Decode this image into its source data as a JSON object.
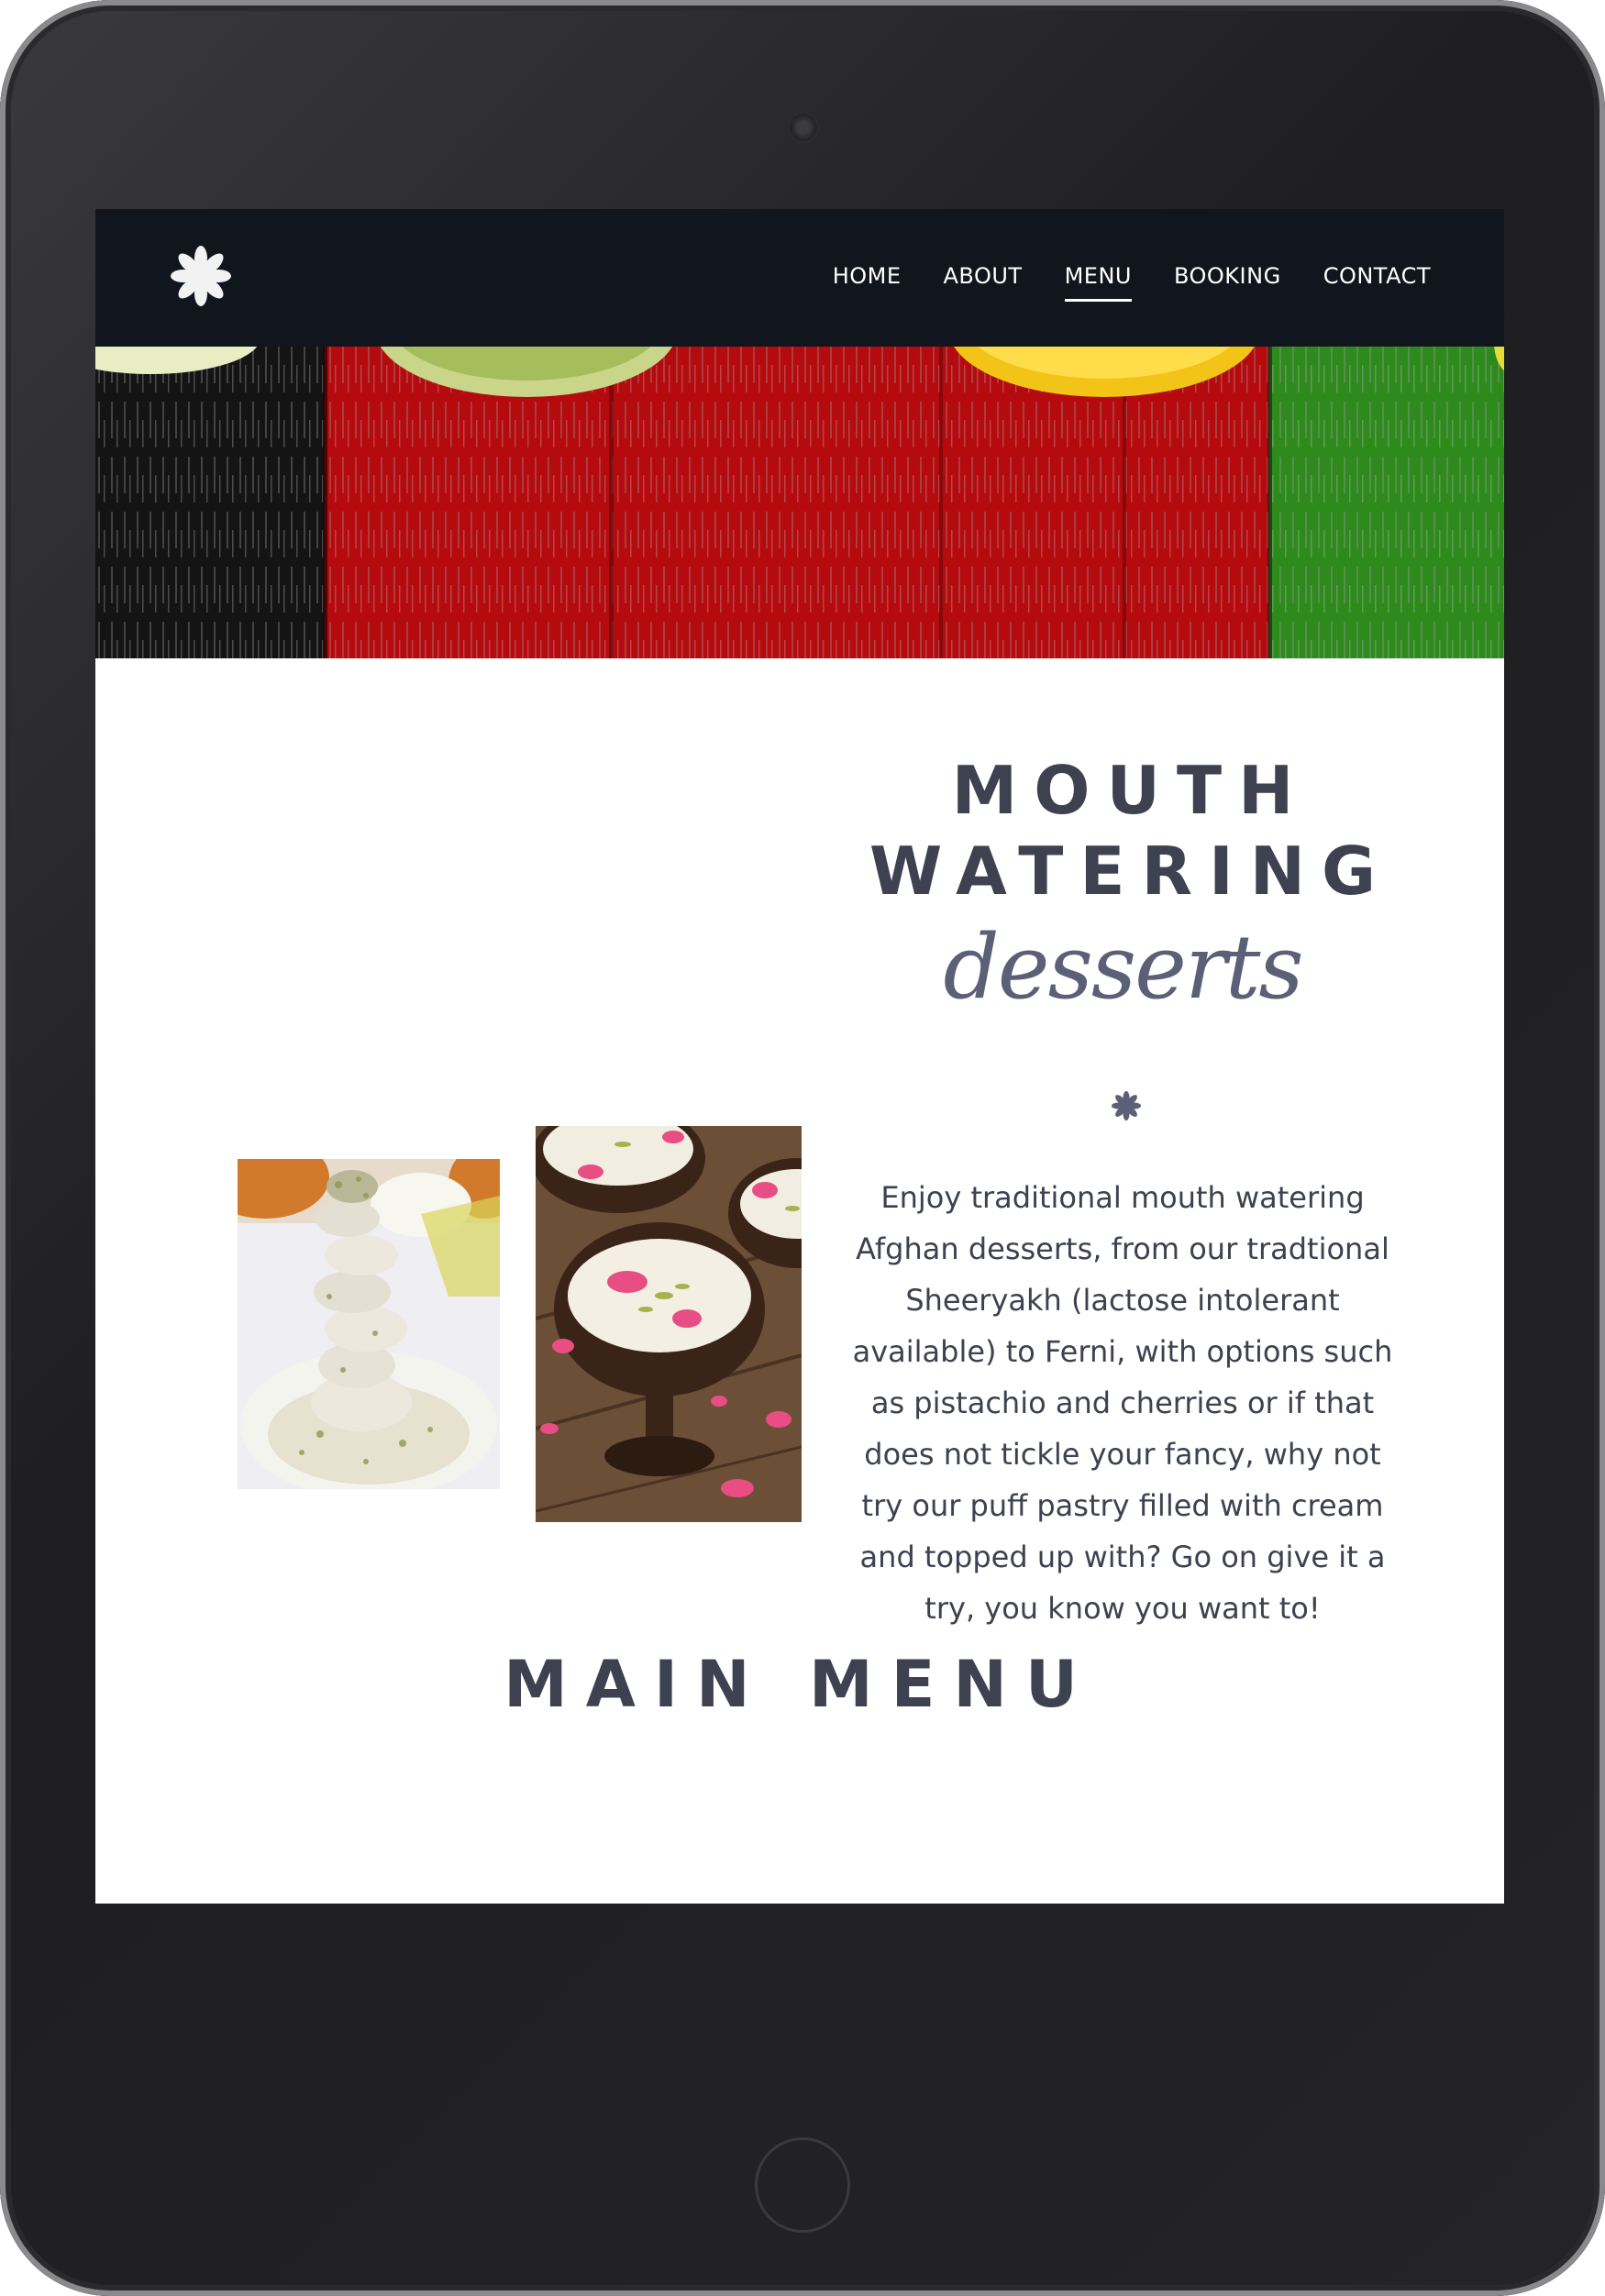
{
  "nav": {
    "items": [
      {
        "label": "HOME",
        "active": false
      },
      {
        "label": "ABOUT",
        "active": false
      },
      {
        "label": "MENU",
        "active": true
      },
      {
        "label": "BOOKING",
        "active": false
      },
      {
        "label": "CONTACT",
        "active": false
      }
    ]
  },
  "headline": {
    "line1": "MOUTH",
    "line2": "WATERING",
    "script": "desserts"
  },
  "description": "Enjoy traditional mouth watering Afghan desserts, from our tradtional Sheeryakh (lactose intolerant available) to Ferni, with options such as pistachio and cherries or if that does not tickle your fancy, why not try our puff pastry filled with cream and topped up with? Go on give it a try, you know you want to!",
  "section_title": "MAIN MENU",
  "colors": {
    "nav_bg": "#11151d",
    "heading": "#3d4150",
    "script": "#5c6077"
  },
  "icons": {
    "logo": "asterisk-flower-icon",
    "divider": "asterisk-icon"
  }
}
